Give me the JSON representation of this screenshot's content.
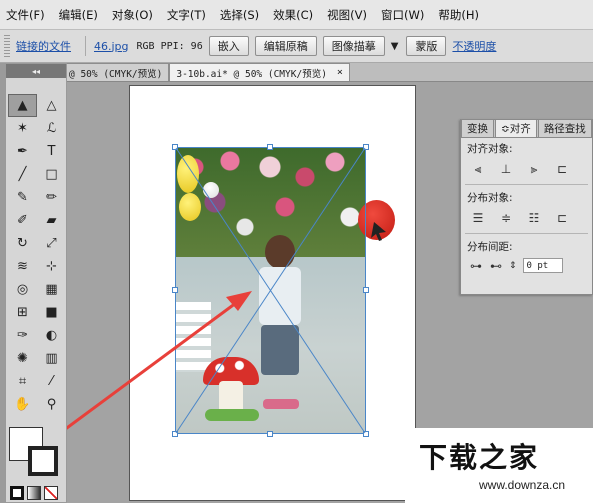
{
  "menubar": {
    "items": [
      "文件(F)",
      "编辑(E)",
      "对象(O)",
      "文字(T)",
      "选择(S)",
      "效果(C)",
      "视图(V)",
      "窗口(W)",
      "帮助(H)"
    ]
  },
  "control_bar": {
    "linked_file_label": "链接的文件",
    "file_name": "46.jpg",
    "color_mode": "RGB",
    "ppi": "PPI: 96",
    "embed_button": "嵌入",
    "edit_original_button": "编辑原稿",
    "image_trace_button": "图像描摹",
    "mask_button": "蒙版",
    "opacity_label": "不透明度"
  },
  "document_tabs": [
    {
      "label": "@ 50% (CMYK/预览)",
      "active": false
    },
    {
      "label": "3-10b.ai* @ 50% (CMYK/预览)",
      "active": true
    }
  ],
  "tabs_close": "×",
  "toolbox": {
    "collapse": "◂◂",
    "tools": [
      {
        "name": "selection-tool-icon",
        "glyph": "▲",
        "selected": true
      },
      {
        "name": "direct-selection-tool-icon",
        "glyph": "△"
      },
      {
        "name": "magic-wand-tool-icon",
        "glyph": "✶"
      },
      {
        "name": "lasso-tool-icon",
        "glyph": "ℒ"
      },
      {
        "name": "pen-tool-icon",
        "glyph": "✒"
      },
      {
        "name": "type-tool-icon",
        "glyph": "T"
      },
      {
        "name": "line-tool-icon",
        "glyph": "╱"
      },
      {
        "name": "rectangle-tool-icon",
        "glyph": "□"
      },
      {
        "name": "paintbrush-tool-icon",
        "glyph": "✎"
      },
      {
        "name": "pencil-tool-icon",
        "glyph": "✏"
      },
      {
        "name": "blob-brush-tool-icon",
        "glyph": "✐"
      },
      {
        "name": "eraser-tool-icon",
        "glyph": "▰"
      },
      {
        "name": "rotate-tool-icon",
        "glyph": "↻"
      },
      {
        "name": "scale-tool-icon",
        "glyph": "⤢"
      },
      {
        "name": "width-tool-icon",
        "glyph": "≋"
      },
      {
        "name": "free-transform-tool-icon",
        "glyph": "⊹"
      },
      {
        "name": "shape-builder-tool-icon",
        "glyph": "◎"
      },
      {
        "name": "perspective-grid-tool-icon",
        "glyph": "▦"
      },
      {
        "name": "mesh-tool-icon",
        "glyph": "⊞"
      },
      {
        "name": "gradient-tool-icon",
        "glyph": "■"
      },
      {
        "name": "eyedropper-tool-icon",
        "glyph": "✑"
      },
      {
        "name": "blend-tool-icon",
        "glyph": "◐"
      },
      {
        "name": "symbol-sprayer-tool-icon",
        "glyph": "✺"
      },
      {
        "name": "column-graph-tool-icon",
        "glyph": "▥"
      },
      {
        "name": "artboard-tool-icon",
        "glyph": "⌗"
      },
      {
        "name": "slice-tool-icon",
        "glyph": "⁄"
      },
      {
        "name": "hand-tool-icon",
        "glyph": "✋"
      },
      {
        "name": "zoom-tool-icon",
        "glyph": "⚲"
      }
    ]
  },
  "align_panel": {
    "tabs": [
      "变换",
      "≎对齐",
      "路径查找"
    ],
    "align_objects_label": "对齐对象:",
    "distribute_objects_label": "分布对象:",
    "distribute_spacing_label": "分布间距:",
    "spacing_value": "0 pt",
    "align_icons": [
      "⫷",
      "⊥",
      "⫸",
      "⊏"
    ],
    "distribute_icons": [
      "☰",
      "≑",
      "☷",
      "⊏"
    ],
    "spacing_icons": [
      "⊶",
      "⊷"
    ]
  },
  "watermark": {
    "logo_text": "下载之家",
    "url": "www.downza.cn"
  },
  "colors": {
    "selection_blue": "#4a86c8",
    "arrow_red": "#e8403a"
  }
}
